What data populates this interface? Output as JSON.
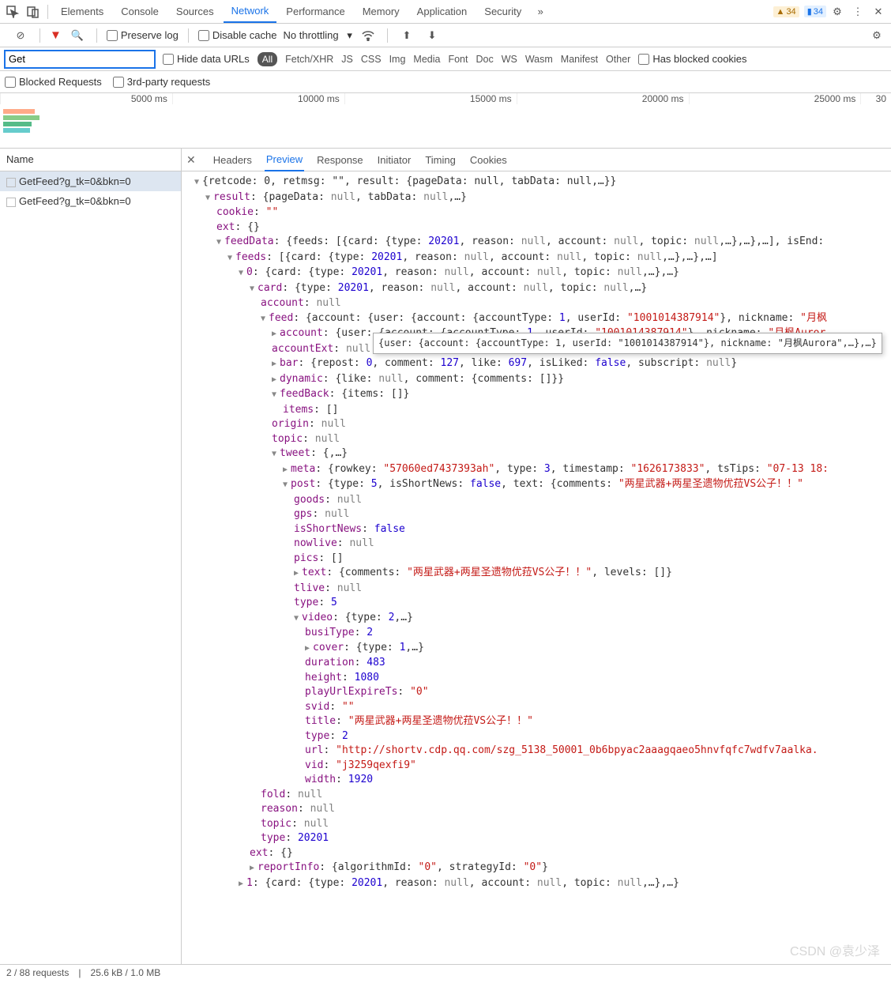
{
  "topTabs": [
    "Elements",
    "Console",
    "Sources",
    "Network",
    "Performance",
    "Memory",
    "Application",
    "Security"
  ],
  "activeTopTab": "Network",
  "badges": {
    "warn": "34",
    "info": "34"
  },
  "toolbar": {
    "preserveLog": "Preserve log",
    "disableCache": "Disable cache",
    "throttle": "No throttling"
  },
  "filter": {
    "value": "Get",
    "hideDataUrls": "Hide data URLs",
    "all": "All",
    "types": [
      "Fetch/XHR",
      "JS",
      "CSS",
      "Img",
      "Media",
      "Font",
      "Doc",
      "WS",
      "Wasm",
      "Manifest",
      "Other"
    ],
    "hasBlocked": "Has blocked cookies",
    "blockedReq": "Blocked Requests",
    "thirdParty": "3rd-party requests"
  },
  "timeline": {
    "ticks": [
      "5000 ms",
      "10000 ms",
      "15000 ms",
      "20000 ms",
      "25000 ms",
      "30"
    ]
  },
  "nameHeader": "Name",
  "requests": [
    "GetFeed?g_tk=0&bkn=0",
    "GetFeed?g_tk=0&bkn=0"
  ],
  "detailTabs": [
    "Headers",
    "Preview",
    "Response",
    "Initiator",
    "Timing",
    "Cookies"
  ],
  "activeDetailTab": "Preview",
  "tooltip": "{user: {account: {accountType: 1, userId: \"1001014387914\"}, nickname: \"月枫Aurora\",…},…}",
  "json": {
    "l0": "{retcode: 0, retmsg: \"\", result: {pageData: null, tabData: null,…}}",
    "l1": "result: {pageData: null, tabData: null,…}",
    "l2": "cookie: \"\"",
    "l3": "ext: {}",
    "l4": "feedData: {feeds: [{card: {type: 20201, reason: null, account: null, topic: null,…},…},…], isEnd:",
    "l5": "feeds: [{card: {type: 20201, reason: null, account: null, topic: null,…},…},…]",
    "l6": "0: {card: {type: 20201, reason: null, account: null, topic: null,…},…}",
    "l7": "card: {type: 20201, reason: null, account: null, topic: null,…}",
    "l8": "account: null",
    "l9": "feed: {account: {user: {account: {accountType: 1, userId: \"1001014387914\"}, nickname: \"月枫",
    "l10": "account: {user: {account: {accountType: 1, userId: \"1001014387914\"}, nickname: \"月枫Auror",
    "l11": "accountExt: null",
    "l12": "bar: {repost: 0, comment: 127, like: 697, isLiked: false, subscript: null}",
    "l13": "dynamic: {like: null, comment: {comments: []}}",
    "l14": "feedBack: {items: []}",
    "l15": "items: []",
    "l16": "origin: null",
    "l17": "topic: null",
    "l18": "tweet: {,…}",
    "l19": "meta: {rowkey: \"57060ed7437393ah\", type: 3, timestamp: \"1626173833\", tsTips: \"07-13 18:",
    "l20": "post: {type: 5, isShortNews: false, text: {comments: \"两星武器+两星圣遗物优菈VS公子！！\"",
    "l21": "goods: null",
    "l22": "gps: null",
    "l23": "isShortNews: false",
    "l24": "nowlive: null",
    "l25": "pics: []",
    "l26": "text: {comments: \"两星武器+两星圣遗物优菈VS公子！！\", levels: []}",
    "l27": "tlive: null",
    "l28": "type: 5",
    "l29": "video: {type: 2,…}",
    "l30": "busiType: 2",
    "l31": "cover: {type: 1,…}",
    "l32": "duration: 483",
    "l33": "height: 1080",
    "l34": "playUrlExpireTs: \"0\"",
    "l35": "svid: \"\"",
    "l36": "title: \"两星武器+两星圣遗物优菈VS公子！！\"",
    "l37": "type: 2",
    "l38": "url: \"http://shortv.cdp.qq.com/szg_5138_50001_0b6bpyac2aaagqaeo5hnvfqfc7wdfv7aalka.",
    "l39": "vid: \"j3259qexfi9\"",
    "l40": "width: 1920",
    "l41": "fold: null",
    "l42": "reason: null",
    "l43": "topic: null",
    "l44": "type: 20201",
    "l45": "ext: {}",
    "l46": "reportInfo: {algorithmId: \"0\", strategyId: \"0\"}",
    "l47": "1: {card: {type: 20201, reason: null, account: null, topic: null,…},…}"
  },
  "status": {
    "req": "2 / 88 requests",
    "size": "25.6 kB / 1.0 MB"
  },
  "watermark": "CSDN @袁少泽"
}
